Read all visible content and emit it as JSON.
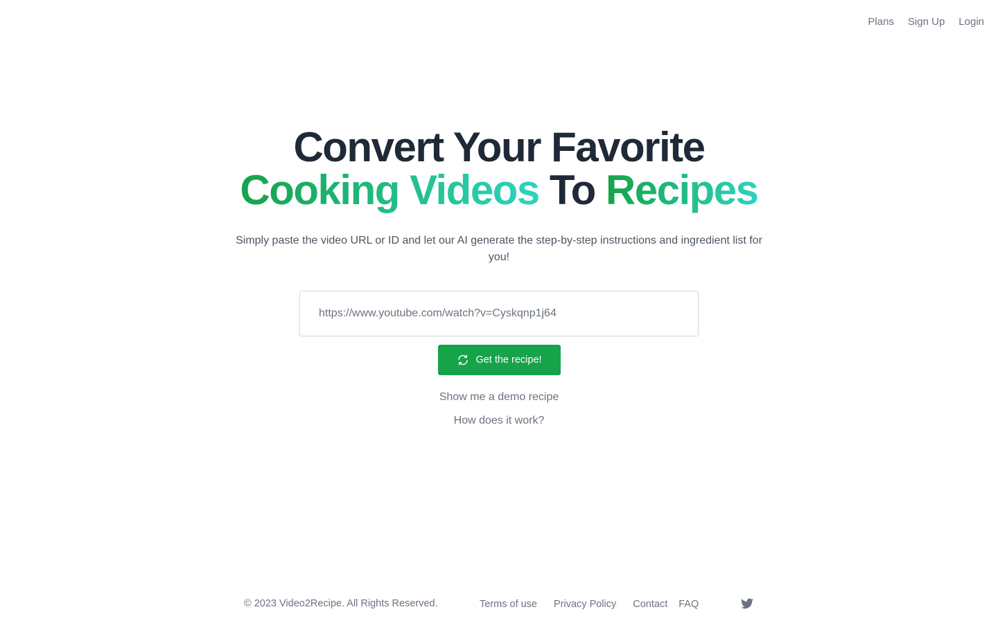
{
  "nav": {
    "plans": "Plans",
    "signup": "Sign Up",
    "login": "Login"
  },
  "hero": {
    "line1": "Convert Your Favorite",
    "highlight1": "Cooking Videos",
    "connector": "To",
    "highlight2": "Recipes",
    "subtitle": "Simply paste the video URL or ID and let our AI generate the step-by-step instructions and ingredient list for you!"
  },
  "form": {
    "url_placeholder": "https://www.youtube.com/watch?v=Cyskqnp1j64",
    "url_value": "",
    "submit_label": "Get the recipe!",
    "submit_icon": "refresh-icon"
  },
  "links": {
    "demo": "Show me a demo recipe",
    "how": "How does it work?"
  },
  "footer": {
    "copyright": "© 2023 Video2Recipe. All Rights Reserved.",
    "terms": "Terms of use",
    "privacy": "Privacy Policy",
    "contact": "Contact",
    "faq": "FAQ",
    "social_icon": "twitter-icon"
  },
  "colors": {
    "brand_green": "#16a34a",
    "gradient_end": "#2dd4bf",
    "heading": "#1f2937",
    "muted": "#6b7280"
  }
}
